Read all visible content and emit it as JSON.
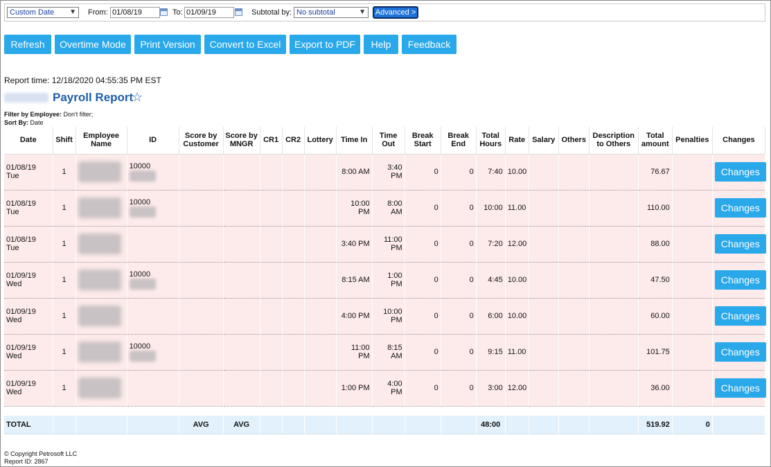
{
  "filters": {
    "range_select": "Custom Date",
    "from_label": "From:",
    "from_value": "01/08/19",
    "to_label": "To:",
    "to_value": "01/09/19",
    "subtotal_label": "Subtotal by:",
    "subtotal_select": "No subtotal",
    "advanced_label": "Advanced >"
  },
  "toolbar": {
    "refresh": "Refresh",
    "overtime": "Overtime Mode",
    "print": "Print Version",
    "excel": "Convert to Excel",
    "pdf": "Export to PDF",
    "help": "Help",
    "feedback": "Feedback"
  },
  "report": {
    "time": "Report time: 12/18/2020 04:55:35 PM EST",
    "title": "Payroll Report",
    "star": "☆",
    "filter_label": "Filter by Employee:",
    "filter_value": " Don't filter;",
    "sort_label": "Sort By:",
    "sort_value": " Date"
  },
  "table": {
    "headers": [
      "Date",
      "Shift",
      "Employee Name",
      "ID",
      "Score by Customer",
      "Score by MNGR",
      "CR1",
      "CR2",
      "Lottery",
      "Time In",
      "Time Out",
      "Break Start",
      "Break End",
      "Total Hours",
      "Rate",
      "Salary",
      "Others",
      "Description to Others",
      "Total amount",
      "Penalties",
      "Changes"
    ],
    "rows": [
      {
        "date": "01/08/19 Tue",
        "shift": "1",
        "id": "10000",
        "time_in": "8:00 AM",
        "time_out": "3:40 PM",
        "break_start": "0",
        "break_end": "0",
        "hours": "7:40",
        "rate": "10.00",
        "amount": "76.67",
        "changes": "Changes"
      },
      {
        "date": "01/08/19 Tue",
        "shift": "1",
        "id": "10000",
        "time_in": "10:00 PM",
        "time_out": "8:00 AM",
        "break_start": "0",
        "break_end": "0",
        "hours": "10:00",
        "rate": "11.00",
        "amount": "110.00",
        "changes": "Changes"
      },
      {
        "date": "01/08/19 Tue",
        "shift": "1",
        "id": "",
        "time_in": "3:40 PM",
        "time_out": "11:00 PM",
        "break_start": "0",
        "break_end": "0",
        "hours": "7:20",
        "rate": "12.00",
        "amount": "88.00",
        "changes": "Changes"
      },
      {
        "date": "01/09/19 Wed",
        "shift": "1",
        "id": "10000",
        "time_in": "8:15 AM",
        "time_out": "1:00 PM",
        "break_start": "0",
        "break_end": "0",
        "hours": "4:45",
        "rate": "10.00",
        "amount": "47.50",
        "changes": "Changes"
      },
      {
        "date": "01/09/19 Wed",
        "shift": "1",
        "id": "",
        "time_in": "4:00 PM",
        "time_out": "10:00 PM",
        "break_start": "0",
        "break_end": "0",
        "hours": "6:00",
        "rate": "10.00",
        "amount": "60.00",
        "changes": "Changes"
      },
      {
        "date": "01/09/19 Wed",
        "shift": "1",
        "id": "10000",
        "time_in": "11:00 PM",
        "time_out": "8:15 AM",
        "break_start": "0",
        "break_end": "0",
        "hours": "9:15",
        "rate": "11.00",
        "amount": "101.75",
        "changes": "Changes"
      },
      {
        "date": "01/09/19 Wed",
        "shift": "1",
        "id": "",
        "time_in": "1:00 PM",
        "time_out": "4:00 PM",
        "break_start": "0",
        "break_end": "0",
        "hours": "3:00",
        "rate": "12.00",
        "amount": "36.00",
        "changes": "Changes"
      }
    ],
    "total": {
      "label": "TOTAL",
      "score_customer": "AVG",
      "score_mngr": "AVG",
      "hours": "48:00",
      "amount": "519.92",
      "penalties": "0"
    }
  },
  "footer": {
    "copyright": "© Copyright Petrosoft LLC",
    "report_id": "Report ID: 2867"
  }
}
